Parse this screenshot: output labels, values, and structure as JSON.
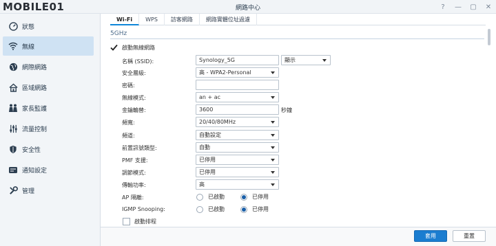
{
  "window": {
    "logo_text": "MOBILE01",
    "title": "網路中心",
    "buttons": [
      "?",
      "—",
      "▢",
      "✕"
    ]
  },
  "sidebar": {
    "items": [
      {
        "label": "狀態",
        "icon": "status-icon",
        "active": false
      },
      {
        "label": "無線",
        "icon": "wifi-icon",
        "active": true
      },
      {
        "label": "網際網路",
        "icon": "globe-icon",
        "active": false
      },
      {
        "label": "區域網路",
        "icon": "house-icon",
        "active": false
      },
      {
        "label": "家長監護",
        "icon": "family-icon",
        "active": false
      },
      {
        "label": "流量控制",
        "icon": "sliders-icon",
        "active": false
      },
      {
        "label": "安全性",
        "icon": "shield-icon",
        "active": false
      },
      {
        "label": "通知設定",
        "icon": "notification-icon",
        "active": false
      },
      {
        "label": "管理",
        "icon": "wrench-icon",
        "active": false
      }
    ]
  },
  "tabs": [
    "Wi-Fi",
    "WPS",
    "訪客網路",
    "網路實體位址過濾"
  ],
  "section": {
    "title": "5GHz",
    "enable_label": "啟動無線網路",
    "enable_checked": true
  },
  "form": {
    "ssid": {
      "label": "名稱 (SSID):",
      "value": "Synology_5G",
      "visibility": "顯示"
    },
    "security": {
      "label": "安全層級:",
      "value": "高 - WPA2-Personal"
    },
    "password": {
      "label": "密碼:",
      "value": ""
    },
    "mode": {
      "label": "無線模式:",
      "value": "an + ac"
    },
    "rotation": {
      "label": "金鑰輪替:",
      "value": "3600",
      "unit": "秒鐘"
    },
    "bandwidth": {
      "label": "頻寬:",
      "value": "20/40/80MHz"
    },
    "channel": {
      "label": "頻道:",
      "value": "自動設定"
    },
    "preamble": {
      "label": "前置訊號類型:",
      "value": "自動"
    },
    "pmf": {
      "label": "PMF 支援:",
      "value": "已停用"
    },
    "modulation": {
      "label": "調節模式:",
      "value": "已停用"
    },
    "power": {
      "label": "傳輸功率:",
      "value": "高"
    },
    "ap_isolation": {
      "label": "AP 隔離:",
      "options": [
        "已啟動",
        "已停用"
      ],
      "selected": "已停用"
    },
    "igmp": {
      "label": "IGMP Snooping:",
      "options": [
        "已啟動",
        "已停用"
      ],
      "selected": "已停用"
    },
    "schedule": {
      "label": "啟動排程",
      "checked": false
    }
  },
  "footer": {
    "apply": "套用",
    "reset": "重置"
  },
  "colors": {
    "accent": "#1b7dd0",
    "sidebar_active": "#cfe2f3"
  }
}
